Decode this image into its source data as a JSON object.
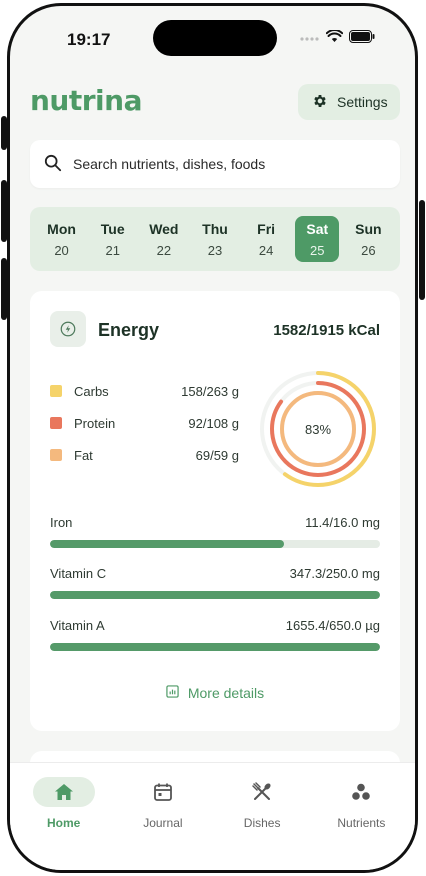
{
  "status_bar": {
    "time": "19:17"
  },
  "app": {
    "brand": "nutrina",
    "settings_label": "Settings"
  },
  "search": {
    "placeholder": "Search nutrients, dishes, foods"
  },
  "days": [
    {
      "name": "Mon",
      "num": "20"
    },
    {
      "name": "Tue",
      "num": "21"
    },
    {
      "name": "Wed",
      "num": "22"
    },
    {
      "name": "Thu",
      "num": "23"
    },
    {
      "name": "Fri",
      "num": "24"
    },
    {
      "name": "Sat",
      "num": "25"
    },
    {
      "name": "Sun",
      "num": "26"
    }
  ],
  "selected_day": "Sat",
  "energy": {
    "title": "Energy",
    "total": "1582/1915 kCal",
    "percent_label": "83%",
    "macros": [
      {
        "label": "Carbs",
        "value": "158/263 g",
        "color": "#f5d36a",
        "progress": 0.6
      },
      {
        "label": "Protein",
        "value": "92/108 g",
        "color": "#e9775d",
        "progress": 0.85
      },
      {
        "label": "Fat",
        "value": "69/59 g",
        "color": "#f4b97e",
        "progress": 1.0
      }
    ]
  },
  "nutrients": [
    {
      "name": "Iron",
      "value": "11.4/16.0 mg",
      "progress": 0.71
    },
    {
      "name": "Vitamin C",
      "value": "347.3/250.0 mg",
      "progress": 1.0
    },
    {
      "name": "Vitamin A",
      "value": "1655.4/650.0 µg",
      "progress": 1.0
    }
  ],
  "more_details_label": "More details",
  "tabs": [
    {
      "label": "Home",
      "icon": "home-icon",
      "active": true
    },
    {
      "label": "Journal",
      "icon": "calendar-icon",
      "active": false
    },
    {
      "label": "Dishes",
      "icon": "utensils-icon",
      "active": false
    },
    {
      "label": "Nutrients",
      "icon": "nutrients-icon",
      "active": false
    }
  ],
  "colors": {
    "accent": "#4e9a66",
    "accent_light": "#e3eee3"
  }
}
